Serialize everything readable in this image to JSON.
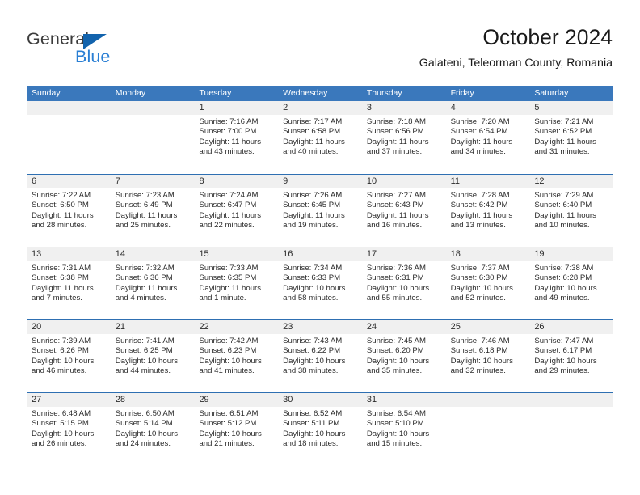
{
  "brand": {
    "word1": "General",
    "word2": "Blue",
    "triangle_color": "#1263ad",
    "word2_color": "#2a7fd4"
  },
  "header": {
    "title": "October 2024",
    "subtitle": "Galateni, Teleorman County, Romania"
  },
  "theme": {
    "header_blue": "#3a78bc",
    "row_divider_blue": "#2e6fb2",
    "day_band_gray": "#f0f0f0"
  },
  "weekdays": [
    "Sunday",
    "Monday",
    "Tuesday",
    "Wednesday",
    "Thursday",
    "Friday",
    "Saturday"
  ],
  "weeks": [
    [
      {
        "day": "",
        "sunrise": "",
        "sunset": "",
        "daylight": ""
      },
      {
        "day": "",
        "sunrise": "",
        "sunset": "",
        "daylight": ""
      },
      {
        "day": "1",
        "sunrise": "Sunrise: 7:16 AM",
        "sunset": "Sunset: 7:00 PM",
        "daylight": "Daylight: 11 hours and 43 minutes."
      },
      {
        "day": "2",
        "sunrise": "Sunrise: 7:17 AM",
        "sunset": "Sunset: 6:58 PM",
        "daylight": "Daylight: 11 hours and 40 minutes."
      },
      {
        "day": "3",
        "sunrise": "Sunrise: 7:18 AM",
        "sunset": "Sunset: 6:56 PM",
        "daylight": "Daylight: 11 hours and 37 minutes."
      },
      {
        "day": "4",
        "sunrise": "Sunrise: 7:20 AM",
        "sunset": "Sunset: 6:54 PM",
        "daylight": "Daylight: 11 hours and 34 minutes."
      },
      {
        "day": "5",
        "sunrise": "Sunrise: 7:21 AM",
        "sunset": "Sunset: 6:52 PM",
        "daylight": "Daylight: 11 hours and 31 minutes."
      }
    ],
    [
      {
        "day": "6",
        "sunrise": "Sunrise: 7:22 AM",
        "sunset": "Sunset: 6:50 PM",
        "daylight": "Daylight: 11 hours and 28 minutes."
      },
      {
        "day": "7",
        "sunrise": "Sunrise: 7:23 AM",
        "sunset": "Sunset: 6:49 PM",
        "daylight": "Daylight: 11 hours and 25 minutes."
      },
      {
        "day": "8",
        "sunrise": "Sunrise: 7:24 AM",
        "sunset": "Sunset: 6:47 PM",
        "daylight": "Daylight: 11 hours and 22 minutes."
      },
      {
        "day": "9",
        "sunrise": "Sunrise: 7:26 AM",
        "sunset": "Sunset: 6:45 PM",
        "daylight": "Daylight: 11 hours and 19 minutes."
      },
      {
        "day": "10",
        "sunrise": "Sunrise: 7:27 AM",
        "sunset": "Sunset: 6:43 PM",
        "daylight": "Daylight: 11 hours and 16 minutes."
      },
      {
        "day": "11",
        "sunrise": "Sunrise: 7:28 AM",
        "sunset": "Sunset: 6:42 PM",
        "daylight": "Daylight: 11 hours and 13 minutes."
      },
      {
        "day": "12",
        "sunrise": "Sunrise: 7:29 AM",
        "sunset": "Sunset: 6:40 PM",
        "daylight": "Daylight: 11 hours and 10 minutes."
      }
    ],
    [
      {
        "day": "13",
        "sunrise": "Sunrise: 7:31 AM",
        "sunset": "Sunset: 6:38 PM",
        "daylight": "Daylight: 11 hours and 7 minutes."
      },
      {
        "day": "14",
        "sunrise": "Sunrise: 7:32 AM",
        "sunset": "Sunset: 6:36 PM",
        "daylight": "Daylight: 11 hours and 4 minutes."
      },
      {
        "day": "15",
        "sunrise": "Sunrise: 7:33 AM",
        "sunset": "Sunset: 6:35 PM",
        "daylight": "Daylight: 11 hours and 1 minute."
      },
      {
        "day": "16",
        "sunrise": "Sunrise: 7:34 AM",
        "sunset": "Sunset: 6:33 PM",
        "daylight": "Daylight: 10 hours and 58 minutes."
      },
      {
        "day": "17",
        "sunrise": "Sunrise: 7:36 AM",
        "sunset": "Sunset: 6:31 PM",
        "daylight": "Daylight: 10 hours and 55 minutes."
      },
      {
        "day": "18",
        "sunrise": "Sunrise: 7:37 AM",
        "sunset": "Sunset: 6:30 PM",
        "daylight": "Daylight: 10 hours and 52 minutes."
      },
      {
        "day": "19",
        "sunrise": "Sunrise: 7:38 AM",
        "sunset": "Sunset: 6:28 PM",
        "daylight": "Daylight: 10 hours and 49 minutes."
      }
    ],
    [
      {
        "day": "20",
        "sunrise": "Sunrise: 7:39 AM",
        "sunset": "Sunset: 6:26 PM",
        "daylight": "Daylight: 10 hours and 46 minutes."
      },
      {
        "day": "21",
        "sunrise": "Sunrise: 7:41 AM",
        "sunset": "Sunset: 6:25 PM",
        "daylight": "Daylight: 10 hours and 44 minutes."
      },
      {
        "day": "22",
        "sunrise": "Sunrise: 7:42 AM",
        "sunset": "Sunset: 6:23 PM",
        "daylight": "Daylight: 10 hours and 41 minutes."
      },
      {
        "day": "23",
        "sunrise": "Sunrise: 7:43 AM",
        "sunset": "Sunset: 6:22 PM",
        "daylight": "Daylight: 10 hours and 38 minutes."
      },
      {
        "day": "24",
        "sunrise": "Sunrise: 7:45 AM",
        "sunset": "Sunset: 6:20 PM",
        "daylight": "Daylight: 10 hours and 35 minutes."
      },
      {
        "day": "25",
        "sunrise": "Sunrise: 7:46 AM",
        "sunset": "Sunset: 6:18 PM",
        "daylight": "Daylight: 10 hours and 32 minutes."
      },
      {
        "day": "26",
        "sunrise": "Sunrise: 7:47 AM",
        "sunset": "Sunset: 6:17 PM",
        "daylight": "Daylight: 10 hours and 29 minutes."
      }
    ],
    [
      {
        "day": "27",
        "sunrise": "Sunrise: 6:48 AM",
        "sunset": "Sunset: 5:15 PM",
        "daylight": "Daylight: 10 hours and 26 minutes."
      },
      {
        "day": "28",
        "sunrise": "Sunrise: 6:50 AM",
        "sunset": "Sunset: 5:14 PM",
        "daylight": "Daylight: 10 hours and 24 minutes."
      },
      {
        "day": "29",
        "sunrise": "Sunrise: 6:51 AM",
        "sunset": "Sunset: 5:12 PM",
        "daylight": "Daylight: 10 hours and 21 minutes."
      },
      {
        "day": "30",
        "sunrise": "Sunrise: 6:52 AM",
        "sunset": "Sunset: 5:11 PM",
        "daylight": "Daylight: 10 hours and 18 minutes."
      },
      {
        "day": "31",
        "sunrise": "Sunrise: 6:54 AM",
        "sunset": "Sunset: 5:10 PM",
        "daylight": "Daylight: 10 hours and 15 minutes."
      },
      {
        "day": "",
        "sunrise": "",
        "sunset": "",
        "daylight": ""
      },
      {
        "day": "",
        "sunrise": "",
        "sunset": "",
        "daylight": ""
      }
    ]
  ]
}
